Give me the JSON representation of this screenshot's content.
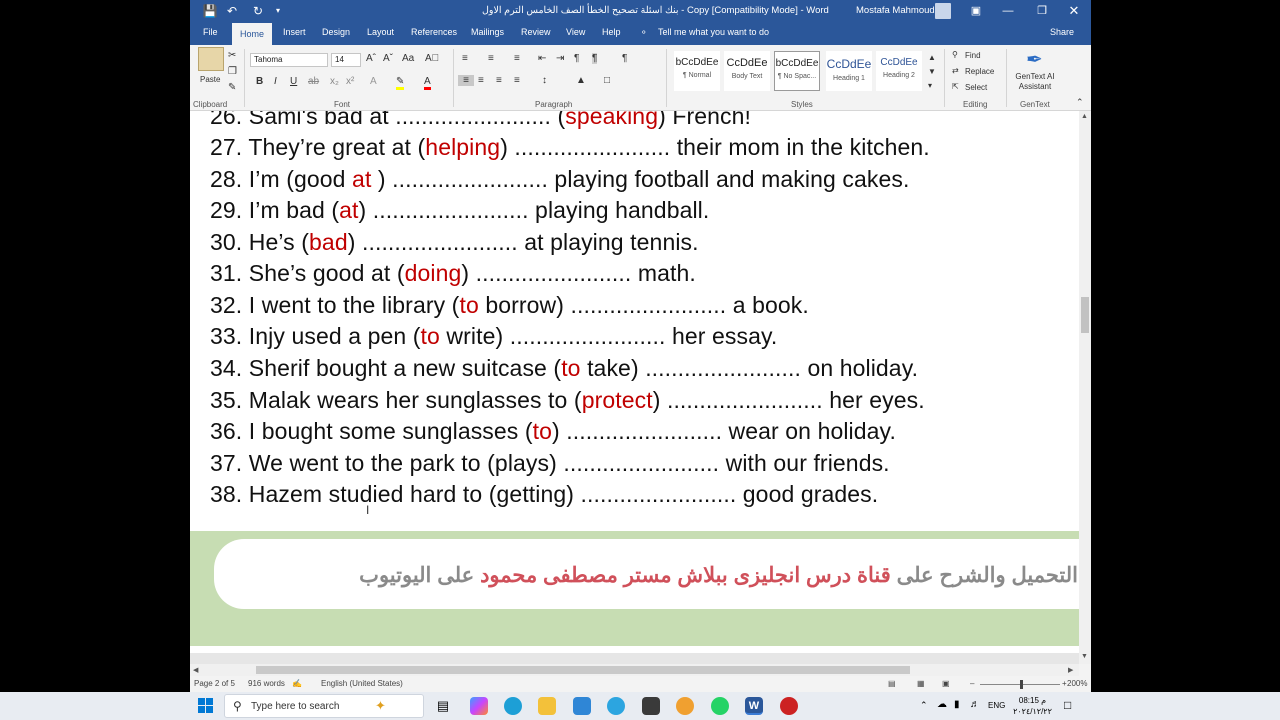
{
  "window": {
    "title": "بنك اسئلة تصحيح الخطأ الصف الخامس الترم الاول - Copy [Compatibility Mode] - Word",
    "user": "Mostafa Mahmoud"
  },
  "tabs": [
    "File",
    "Home",
    "Insert",
    "Design",
    "Layout",
    "References",
    "Mailings",
    "Review",
    "View",
    "Help"
  ],
  "tell_me": "Tell me what you want to do",
  "share": "Share",
  "ribbon": {
    "paste": "Paste",
    "clipboard": "Clipboard",
    "font_name": "Tahoma",
    "font_size": "14",
    "font": "Font",
    "paragraph": "Paragraph",
    "styles_label": "Styles",
    "styles": [
      {
        "sample": "bCcDdEe",
        "name": "¶ Normal"
      },
      {
        "sample": "CcDdEe",
        "name": "Body Text"
      },
      {
        "sample": "bCcDdEe",
        "name": "¶ No Spac..."
      },
      {
        "sample": "CcDdEe",
        "name": "Heading 1"
      },
      {
        "sample": "CcDdEe",
        "name": "Heading 2"
      }
    ],
    "find": "Find",
    "replace": "Replace",
    "select": "Select",
    "editing": "Editing",
    "gentext_assistant": "GenText AI Assistant",
    "gentext": "GenText"
  },
  "document": {
    "lines": [
      {
        "num": "26.",
        "parts": [
          {
            "t": "Sami's bad at ........................   ("
          },
          {
            "t": "speaking",
            "red": true
          },
          {
            "t": ") French!"
          }
        ]
      },
      {
        "num": "27.",
        "parts": [
          {
            "t": "They’re great at ("
          },
          {
            "t": "helping",
            "red": true
          },
          {
            "t": ") ........................ their mom in the kitchen."
          }
        ]
      },
      {
        "num": "28.",
        "parts": [
          {
            "t": "I’m (good "
          },
          {
            "t": "at",
            "red": true
          },
          {
            "t": " ) ........................ playing football and making cakes."
          }
        ]
      },
      {
        "num": "29.",
        "parts": [
          {
            "t": "I’m bad ("
          },
          {
            "t": "at",
            "red": true
          },
          {
            "t": ") ........................ playing handball."
          }
        ]
      },
      {
        "num": "30.",
        "parts": [
          {
            "t": "He’s ("
          },
          {
            "t": "bad",
            "red": true
          },
          {
            "t": ") ........................ at playing tennis."
          }
        ]
      },
      {
        "num": "31.",
        "parts": [
          {
            "t": "She’s good at ("
          },
          {
            "t": "doing",
            "red": true
          },
          {
            "t": ") ........................ math."
          }
        ]
      },
      {
        "num": "32.",
        "parts": [
          {
            "t": "I went to the library ("
          },
          {
            "t": "to",
            "red": true
          },
          {
            "t": " borrow) ........................ a book."
          }
        ]
      },
      {
        "num": "33.",
        "parts": [
          {
            "t": "Injy used a pen ("
          },
          {
            "t": "to",
            "red": true
          },
          {
            "t": " write) ........................ her essay."
          }
        ]
      },
      {
        "num": "34.",
        "parts": [
          {
            "t": "Sherif bought a new suitcase ("
          },
          {
            "t": "to",
            "red": true
          },
          {
            "t": " take) ........................ on holiday."
          }
        ]
      },
      {
        "num": "35.",
        "parts": [
          {
            "t": "Malak wears her sunglasses to ("
          },
          {
            "t": "protect",
            "red": true
          },
          {
            "t": ") ........................ her eyes."
          }
        ]
      },
      {
        "num": "36.",
        "parts": [
          {
            "t": "I bought some sunglasses ("
          },
          {
            "t": "to",
            "red": true
          },
          {
            "t": ") ........................ wear on holiday."
          }
        ]
      },
      {
        "num": "37.",
        "parts": [
          {
            "t": "We went to the park to (plays) ........................ with our friends."
          }
        ]
      },
      {
        "num": "38.",
        "parts": [
          {
            "t": "Hazem studied hard to (getting) ........................ good grades."
          }
        ]
      }
    ],
    "banner": {
      "part1": "التحميل والشرح على",
      "part2": "قناة درس انجليزى ببلاش مستر مصطفى محمود",
      "part3": "على اليوتيوب"
    }
  },
  "status": {
    "page": "Page 2 of 5",
    "words": "916 words",
    "language": "English (United States)",
    "zoom": "200%"
  },
  "taskbar": {
    "search_placeholder": "Type here to search",
    "lang": "ENG",
    "time": "08:15 م",
    "date": "٢٠٢٤/١٢/٢٢"
  }
}
